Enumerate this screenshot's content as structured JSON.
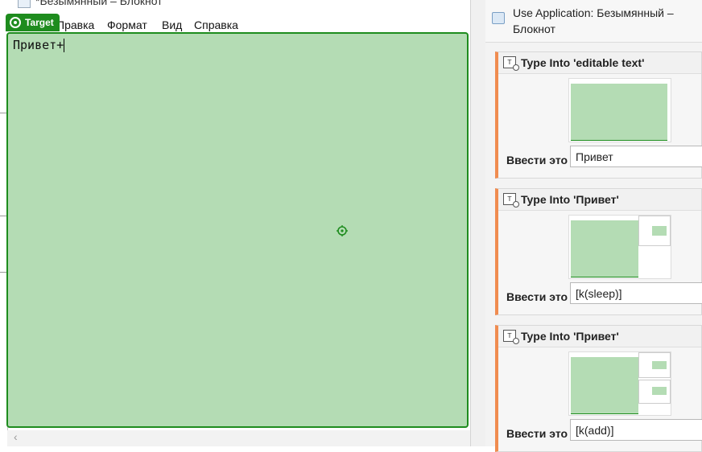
{
  "notepad": {
    "title": "*Безымянный – Блокнот",
    "menu": [
      "Правка",
      "Формат",
      "Вид",
      "Справка"
    ],
    "target_label": "Target",
    "editor_text": "Привет+"
  },
  "designer": {
    "app_title": "Use Application: Безымянный – Блокнот",
    "activities": [
      {
        "title": "Type Into 'editable text'",
        "field_label": "Ввести это",
        "field_value": "Привет"
      },
      {
        "title": "Type Into 'Привет'",
        "field_label": "Ввести это",
        "field_value": "[k(sleep)]"
      },
      {
        "title": "Type Into 'Привет'",
        "field_label": "Ввести это",
        "field_value": "[k(add)]"
      }
    ]
  },
  "colors": {
    "target_fill": "#b4dcb4",
    "target_border": "#1e8c1e",
    "activity_accent": "#f08c50"
  }
}
